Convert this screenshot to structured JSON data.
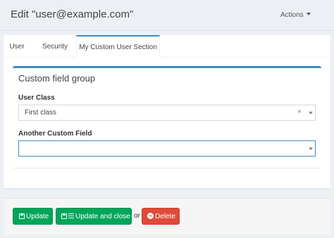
{
  "header": {
    "title": "Edit \"user@example.com\"",
    "actions_label": "Actions"
  },
  "tabs": [
    {
      "label": "User",
      "active": false
    },
    {
      "label": "Security",
      "active": false
    },
    {
      "label": "My Custom User Section",
      "active": true
    }
  ],
  "form": {
    "group_title": "Custom field group",
    "fields": [
      {
        "label": "User Class",
        "value": "First class",
        "clear_icon": "×",
        "icon": "chevron-down-icon"
      },
      {
        "label": "Another Custom Field",
        "value": "",
        "icon": "chevron-down-icon"
      }
    ]
  },
  "footer": {
    "update_label": "Update",
    "update_close_label": "Update and close",
    "or_text": "or",
    "delete_label": "Delete"
  },
  "colors": {
    "accent": "#3c8dbc",
    "success": "#00a65a",
    "danger": "#dd4b39"
  }
}
